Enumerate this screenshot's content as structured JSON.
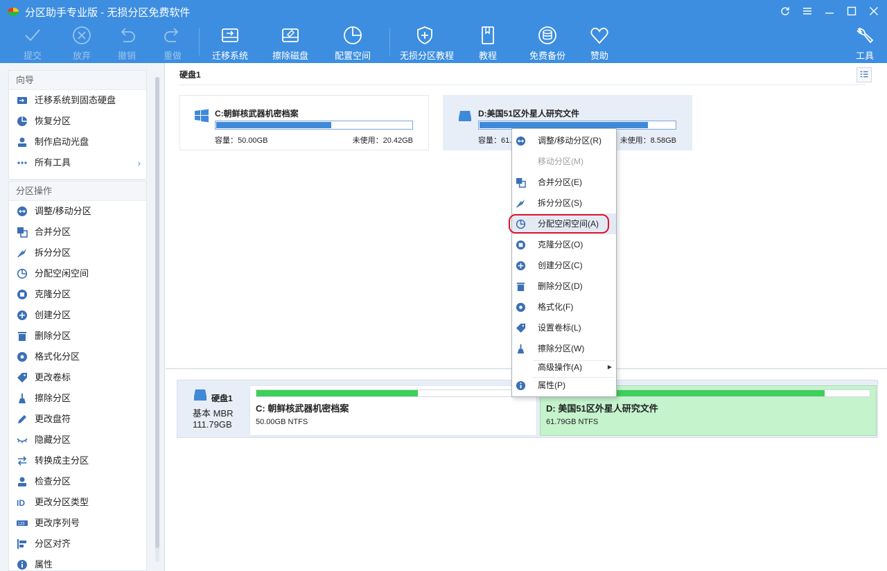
{
  "app": {
    "title": "分区助手专业版 - 无损分区免费软件"
  },
  "toolbar": {
    "items": [
      {
        "label": "提交",
        "icon": "check-icon",
        "enabled": false
      },
      {
        "label": "放弃",
        "icon": "cancel-circle-icon",
        "enabled": false
      },
      {
        "label": "撤销",
        "icon": "undo-icon",
        "enabled": false
      },
      {
        "label": "重做",
        "icon": "redo-icon",
        "enabled": false
      },
      {
        "label": "迁移系统",
        "icon": "migrate-disk-icon",
        "enabled": true
      },
      {
        "label": "擦除磁盘",
        "icon": "wipe-disk-icon",
        "enabled": true
      },
      {
        "label": "配置空间",
        "icon": "allocate-pie-icon",
        "enabled": true
      },
      {
        "label": "无损分区教程",
        "icon": "shield-plus-icon",
        "enabled": true
      },
      {
        "label": "教程",
        "icon": "book-icon",
        "enabled": true
      },
      {
        "label": "免费备份",
        "icon": "backup-icon",
        "enabled": true
      },
      {
        "label": "赞助",
        "icon": "heart-icon",
        "enabled": true
      }
    ],
    "tools_label": "工具"
  },
  "sidebar": {
    "guide_title": "向导",
    "guide_items": [
      {
        "label": "迁移系统到固态硬盘",
        "icon": "migrate-ssd-icon"
      },
      {
        "label": "恢复分区",
        "icon": "recover-partition-icon"
      },
      {
        "label": "制作启动光盘",
        "icon": "bootable-media-icon"
      },
      {
        "label": "所有工具",
        "icon": "more-tools-icon"
      }
    ],
    "ops_title": "分区操作",
    "ops_items": [
      {
        "label": "调整/移动分区",
        "icon": "resize-move-icon"
      },
      {
        "label": "合并分区",
        "icon": "merge-icon"
      },
      {
        "label": "拆分分区",
        "icon": "split-icon"
      },
      {
        "label": "分配空闲空间",
        "icon": "allocate-space-icon"
      },
      {
        "label": "克隆分区",
        "icon": "clone-icon"
      },
      {
        "label": "创建分区",
        "icon": "create-partition-icon"
      },
      {
        "label": "删除分区",
        "icon": "trash-icon"
      },
      {
        "label": "格式化分区",
        "icon": "format-icon"
      },
      {
        "label": "更改卷标",
        "icon": "tag-icon"
      },
      {
        "label": "擦除分区",
        "icon": "broom-icon"
      },
      {
        "label": "更改盘符",
        "icon": "pencil-icon"
      },
      {
        "label": "隐藏分区",
        "icon": "eye-hidden-icon"
      },
      {
        "label": "转换成主分区",
        "icon": "convert-icon"
      },
      {
        "label": "检查分区",
        "icon": "check-partition-icon"
      },
      {
        "label": "更改分区类型",
        "icon": "id-icon"
      },
      {
        "label": "更改序列号",
        "icon": "serial-icon"
      },
      {
        "label": "分区对齐",
        "icon": "align-icon"
      },
      {
        "label": "属性",
        "icon": "info-icon"
      }
    ]
  },
  "disk": {
    "title": "硬盘1",
    "partitions": [
      {
        "title": "C:朝鲜核武器机密档案",
        "capacity": "容量：50.00GB",
        "free": "未使用：20.42GB",
        "used_fraction": 0.59,
        "icon": "windows-icon"
      },
      {
        "title": "D:美国51区外星人研究文件",
        "capacity": "容量：61.79GB",
        "free": "未使用：8.58GB",
        "used_fraction": 0.86,
        "icon": "drive-icon"
      }
    ]
  },
  "diskmap": {
    "name": "硬盘1",
    "type": "基本 MBR",
    "size": "111.79GB",
    "partitions": [
      {
        "name": "C: 朝鲜核武器机密档案",
        "info": "50.00GB NTFS",
        "used_fraction": 0.59
      },
      {
        "name": "D: 美国51区外星人研究文件",
        "info": "61.79GB NTFS",
        "used_fraction": 0.86
      }
    ]
  },
  "context_menu": {
    "items": [
      {
        "label": "调整/移动分区(R)",
        "icon": "resize-move-icon",
        "enabled": true
      },
      {
        "label": "移动分区(M)",
        "icon": "",
        "enabled": false
      },
      {
        "label": "合并分区(E)",
        "icon": "merge-icon",
        "enabled": true
      },
      {
        "label": "拆分分区(S)",
        "icon": "split-icon",
        "enabled": true
      },
      {
        "label": "分配空闲空间(A)",
        "icon": "allocate-space-icon",
        "enabled": true,
        "highlighted": true
      },
      {
        "label": "克隆分区(O)",
        "icon": "clone-icon",
        "enabled": true
      },
      {
        "label": "创建分区(C)",
        "icon": "create-partition-icon",
        "enabled": true
      },
      {
        "label": "删除分区(D)",
        "icon": "trash-icon",
        "enabled": true
      },
      {
        "label": "格式化(F)",
        "icon": "format-icon",
        "enabled": true
      },
      {
        "label": "设置卷标(L)",
        "icon": "tag-icon",
        "enabled": true
      },
      {
        "label": "擦除分区(W)",
        "icon": "broom-icon",
        "enabled": true
      },
      {
        "label": "高级操作(A)",
        "icon": "",
        "enabled": true,
        "submenu": true
      },
      {
        "label": "属性(P)",
        "icon": "info-icon",
        "enabled": true
      }
    ]
  }
}
